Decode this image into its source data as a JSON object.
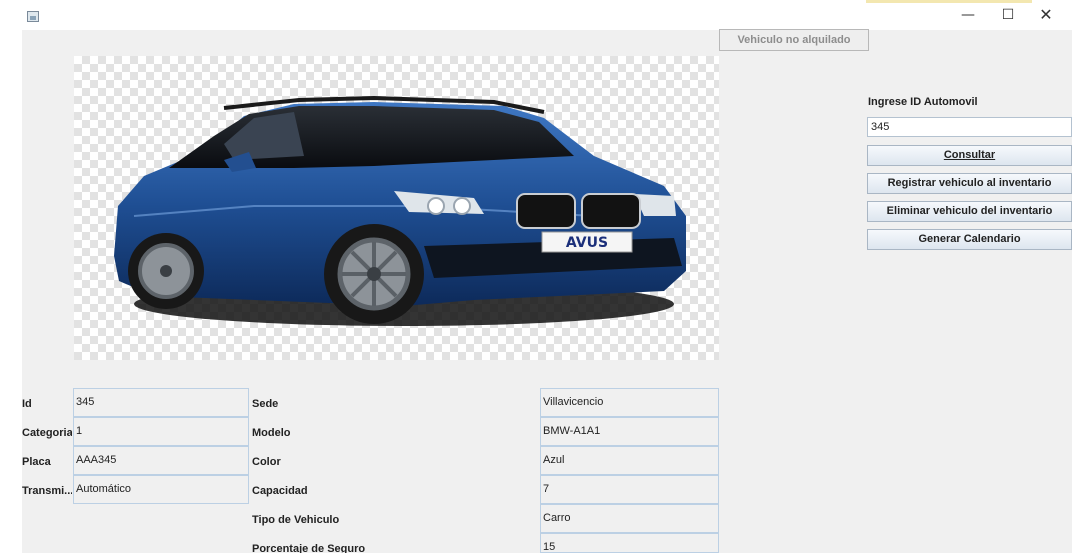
{
  "window": {
    "minimize_glyph": "—",
    "maximize_glyph": "☐",
    "close_glyph": "✕"
  },
  "status_button": "Vehiculo no alquilado",
  "car_image": {
    "plate_text": "AVUS",
    "body_color": "#1f4f94"
  },
  "sidebar": {
    "id_label": "Ingrese ID Automovil",
    "id_value": "345",
    "buttons": {
      "consultar": "Consultar",
      "registrar": "Registrar vehiculo al inventario",
      "eliminar": "Eliminar vehiculo del inventario",
      "calendario": "Generar Calendario"
    }
  },
  "left_fields": [
    {
      "label": "Id",
      "value": "345"
    },
    {
      "label": "Categoria",
      "value": "1"
    },
    {
      "label": "Placa",
      "value": "AAA345"
    },
    {
      "label": "Transmi...",
      "value": "Automático"
    }
  ],
  "right_fields": [
    {
      "label": "Sede",
      "value": "Villavicencio"
    },
    {
      "label": "Modelo",
      "value": "BMW-A1A1"
    },
    {
      "label": "Color",
      "value": "Azul"
    },
    {
      "label": "Capacidad",
      "value": "7"
    },
    {
      "label": "Tipo de Vehiculo",
      "value": "Carro"
    },
    {
      "label": "Porcentaje de Seguro",
      "value": "15"
    }
  ]
}
